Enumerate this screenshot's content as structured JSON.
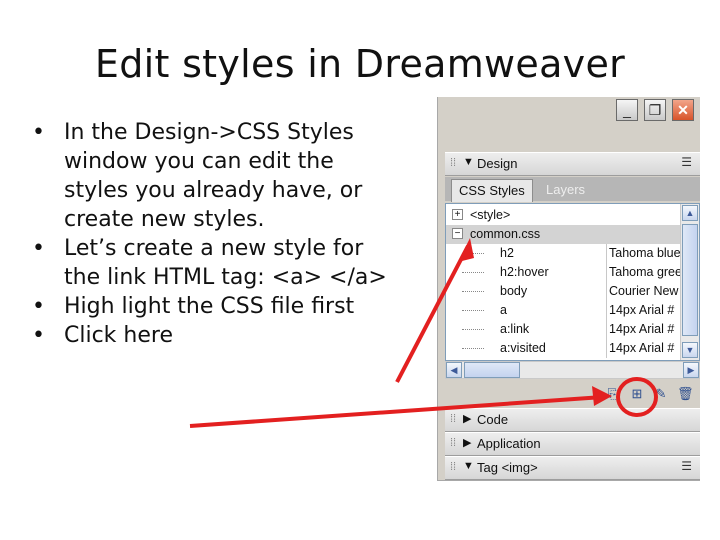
{
  "slide": {
    "title": "Edit styles in Dreamweaver",
    "bullets": [
      "In the Design->CSS Styles window you can edit the styles you already have, or create new styles.",
      "Let’s create a new style for the link HTML tag: <a> </a>",
      "High light the CSS file first",
      "Click here"
    ]
  },
  "panel": {
    "window_controls": {
      "minimize": "_",
      "maximize": "❐",
      "close": "✕"
    },
    "groups": {
      "design": "Design",
      "code": "Code",
      "application": "Application",
      "tag": "Tag <img>"
    },
    "tabs": {
      "active": "CSS Styles",
      "inactive": "Layers"
    },
    "tree": [
      {
        "name": "<style>",
        "expander": "+",
        "property": "",
        "selected": false
      },
      {
        "name": "common.css",
        "expander": "−",
        "property": "",
        "selected": true
      },
      {
        "name": "h2",
        "property": "Tahoma blue"
      },
      {
        "name": "h2:hover",
        "property": "Tahoma green"
      },
      {
        "name": "body",
        "property": "Courier New"
      },
      {
        "name": "a",
        "property": "14px Arial #"
      },
      {
        "name": "a:link",
        "property": "14px Arial #"
      },
      {
        "name": "a:visited",
        "property": "14px Arial #"
      }
    ],
    "toolbar": {
      "attach_icon": "attach-style-sheet-icon",
      "new_icon": "new-css-rule-icon",
      "edit_icon": "edit-style-icon",
      "delete_icon": "delete-css-rule-icon"
    }
  },
  "annotations": {
    "arrow_color": "#e32020",
    "circle_color": "#e32020"
  }
}
